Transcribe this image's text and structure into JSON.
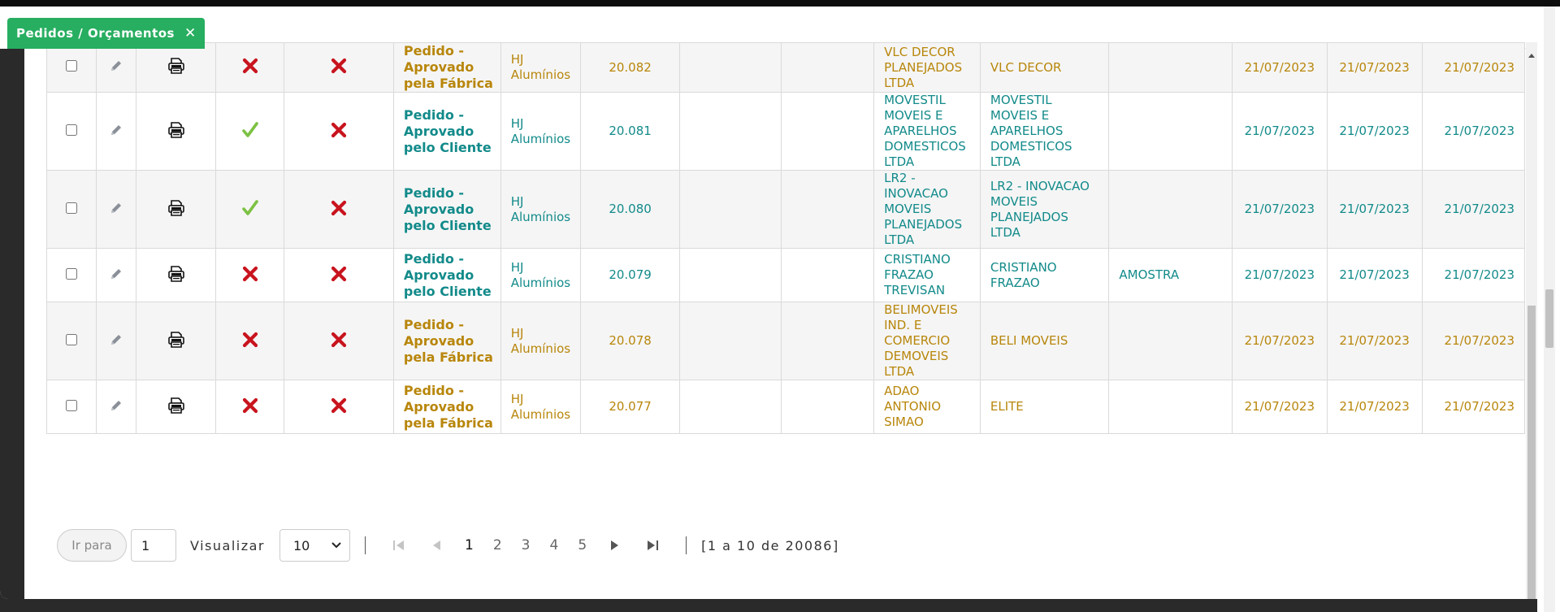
{
  "tab": {
    "label": "Pedidos / Orçamentos",
    "close": "✕"
  },
  "rows": [
    {
      "status": "Pedido - Aprovado pela Fábrica",
      "color": "gold",
      "a": "x",
      "b": "x",
      "company": "HJ Alumínios",
      "number": "20.082",
      "client": "VLC DECOR PLANEJADOS LTDA",
      "fantasy": "VLC DECOR",
      "obs": "",
      "date1": "21/07/2023",
      "date2": "21/07/2023",
      "date3": "21/07/2023"
    },
    {
      "status": "Pedido - Aprovado pelo Cliente",
      "color": "teal",
      "a": "check",
      "b": "x",
      "company": "HJ Alumínios",
      "number": "20.081",
      "client": "MOVESTIL MOVEIS E APARELHOS DOMESTICOS LTDA",
      "fantasy": "MOVESTIL MOVEIS E APARELHOS DOMESTICOS LTDA",
      "obs": "",
      "date1": "21/07/2023",
      "date2": "21/07/2023",
      "date3": "21/07/2023"
    },
    {
      "status": "Pedido - Aprovado pelo Cliente",
      "color": "teal",
      "a": "check",
      "b": "x",
      "company": "HJ Alumínios",
      "number": "20.080",
      "client": "LR2 - INOVACAO MOVEIS PLANEJADOS LTDA",
      "fantasy": "LR2 - INOVACAO MOVEIS PLANEJADOS LTDA",
      "obs": "",
      "date1": "21/07/2023",
      "date2": "21/07/2023",
      "date3": "21/07/2023"
    },
    {
      "status": "Pedido - Aprovado pelo Cliente",
      "color": "teal",
      "a": "x",
      "b": "x",
      "company": "HJ Alumínios",
      "number": "20.079",
      "client": "CRISTIANO FRAZAO TREVISAN",
      "fantasy": "CRISTIANO FRAZAO",
      "obs": "AMOSTRA",
      "date1": "21/07/2023",
      "date2": "21/07/2023",
      "date3": "21/07/2023"
    },
    {
      "status": "Pedido - Aprovado pela Fábrica",
      "color": "gold",
      "a": "x",
      "b": "x",
      "company": "HJ Alumínios",
      "number": "20.078",
      "client": "BELIMOVEIS IND. E COMERCIO DEMOVEIS LTDA",
      "fantasy": "BELI MOVEIS",
      "obs": "",
      "date1": "21/07/2023",
      "date2": "21/07/2023",
      "date3": "21/07/2023"
    },
    {
      "status": "Pedido - Aprovado pela Fábrica",
      "color": "gold",
      "a": "x",
      "b": "x",
      "company": "HJ Alumínios",
      "number": "20.077",
      "client": "ADAO ANTONIO SIMAO",
      "fantasy": "ELITE",
      "obs": "",
      "date1": "21/07/2023",
      "date2": "21/07/2023",
      "date3": "21/07/2023"
    }
  ],
  "pagination": {
    "goto_label": "Ir para",
    "goto_value": "1",
    "view_label": "Visualizar",
    "page_size": "10",
    "pages": [
      "1",
      "2",
      "3",
      "4",
      "5"
    ],
    "current_page": "1",
    "info": "[1 a 10 de 20086]"
  },
  "colors": {
    "accent": "#27ae60",
    "gold": "#b8860b",
    "teal": "#138a8a",
    "x_red": "#c8141e",
    "check_green": "#7cc142"
  }
}
